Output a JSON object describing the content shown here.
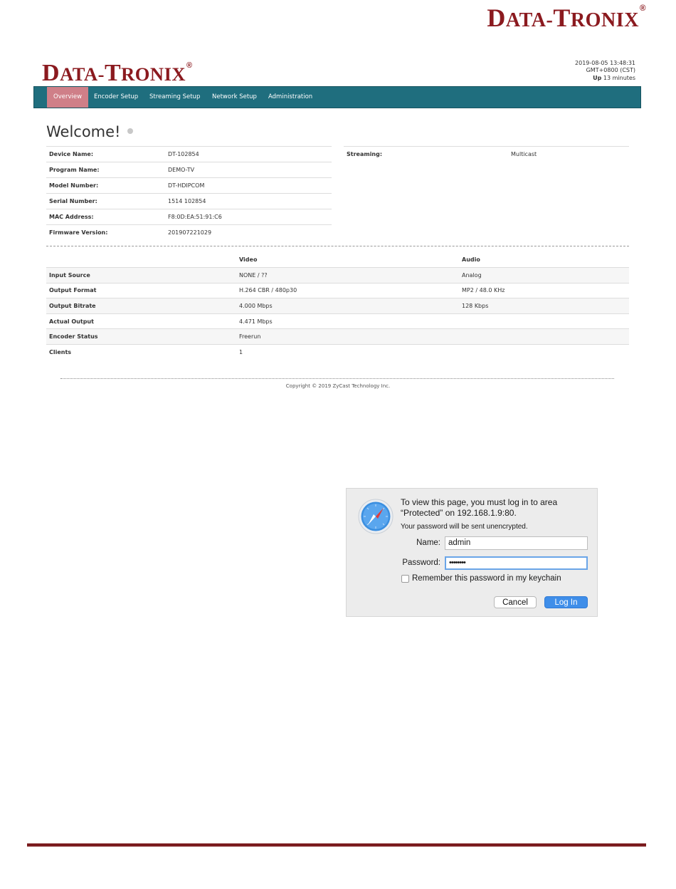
{
  "brand": {
    "logo_main": "D",
    "logo_rest1": "ATA-",
    "logo_t": "T",
    "logo_rest2": "RONIX",
    "registered": "®",
    "color": "#8b1a1f"
  },
  "status": {
    "datetime": "2019-08-05 13:48:31",
    "timezone": "GMT+0800 (CST)",
    "uptime_label": "Up",
    "uptime_value": "13 minutes"
  },
  "nav": {
    "tabs": [
      "Overview",
      "Encoder Setup",
      "Streaming Setup",
      "Network Setup",
      "Administration"
    ],
    "active": "Overview",
    "bar_color": "#1f6e7e",
    "active_color": "#cf7f88"
  },
  "welcome": "Welcome!",
  "device": {
    "rows": [
      {
        "label": "Device Name:",
        "value": "DT-102854"
      },
      {
        "label": "Program Name:",
        "value": "DEMO-TV"
      },
      {
        "label": "Model Number:",
        "value": "DT-HDIPCOM"
      },
      {
        "label": "Serial Number:",
        "value": "1514 102854"
      },
      {
        "label": "MAC Address:",
        "value": "F8:0D:EA:51:91:C6"
      },
      {
        "label": "Firmware Version:",
        "value": "201907221029"
      }
    ]
  },
  "streaming": {
    "label": "Streaming:",
    "value": "Multicast"
  },
  "status_table": {
    "headers": [
      "",
      "Video",
      "Audio"
    ],
    "rows": [
      {
        "label": "Input Source",
        "video": "NONE / ??",
        "audio": "Analog"
      },
      {
        "label": "Output Format",
        "video": "H.264 CBR / 480p30",
        "audio": "MP2 / 48.0 KHz"
      },
      {
        "label": "Output Bitrate",
        "video": "4.000 Mbps",
        "audio": "128 Kbps"
      },
      {
        "label": "Actual Output",
        "video": "4.471 Mbps",
        "audio": ""
      },
      {
        "label": "Encoder Status",
        "video": "Freerun",
        "audio": ""
      },
      {
        "label": "Clients",
        "video": "1",
        "audio": ""
      }
    ]
  },
  "copyright": "Copyright © 2019 ZyCast Technology Inc.",
  "login_dialog": {
    "message": "To view this page, you must log in to area “Protected” on 192.168.1.9:80.",
    "sub_message": "Your password will be sent unencrypted.",
    "name_label": "Name:",
    "name_value": "admin",
    "password_label": "Password:",
    "password_value": "••••••••",
    "remember_label": "Remember this password in my keychain",
    "remember_checked": false,
    "cancel_label": "Cancel",
    "login_label": "Log In"
  }
}
